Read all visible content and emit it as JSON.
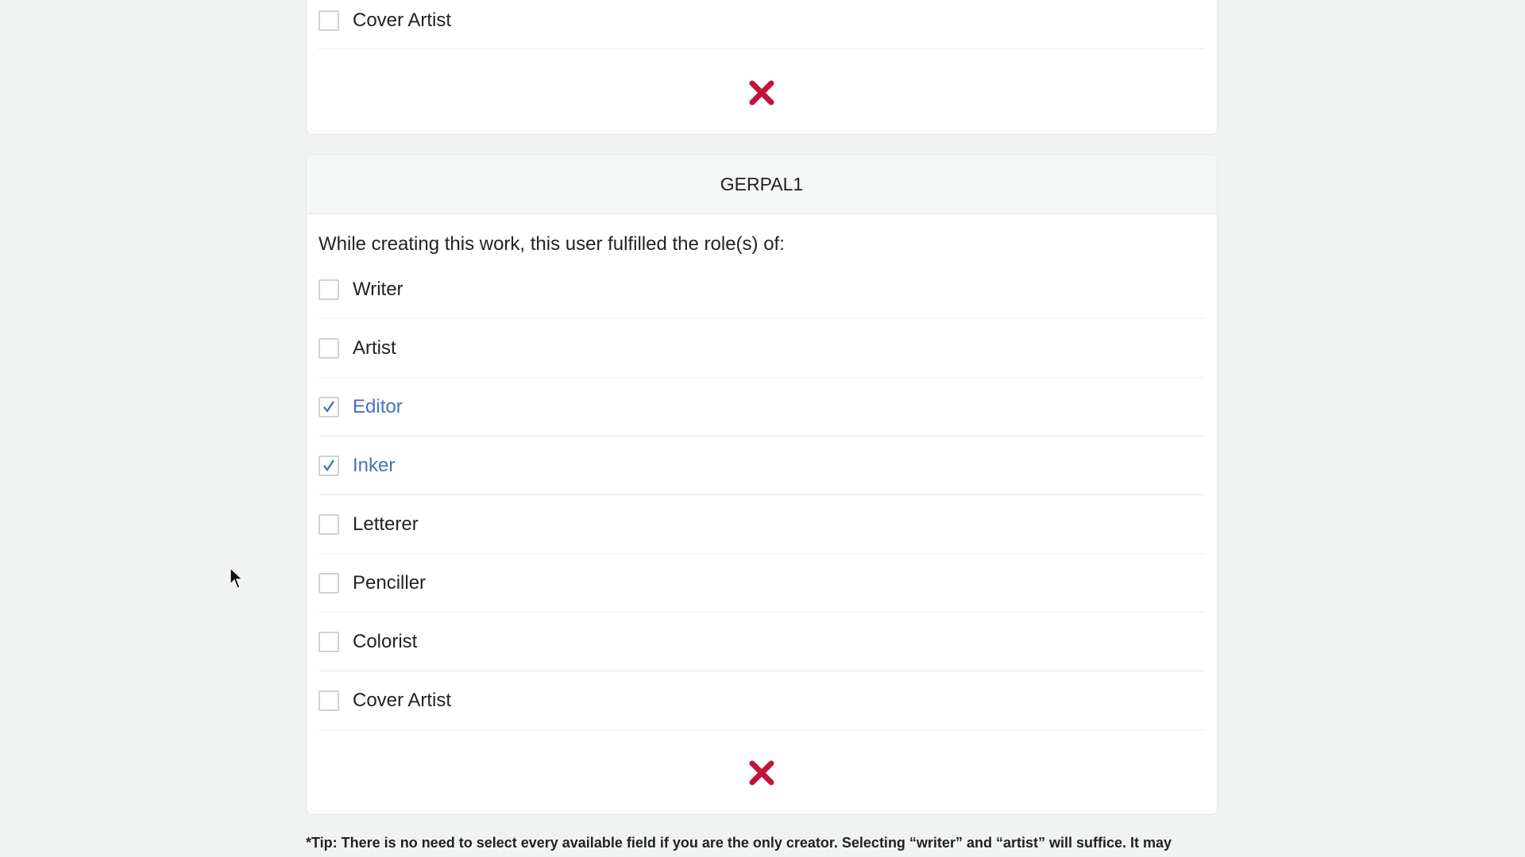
{
  "previous_card": {
    "roles": [
      {
        "label": "Cover Artist",
        "checked": false
      }
    ]
  },
  "card": {
    "username": "GERPAL1",
    "prompt": "While creating this work, this user fulfilled the role(s) of:",
    "roles": [
      {
        "label": "Writer",
        "checked": false
      },
      {
        "label": "Artist",
        "checked": false
      },
      {
        "label": "Editor",
        "checked": true
      },
      {
        "label": "Inker",
        "checked": true
      },
      {
        "label": "Letterer",
        "checked": false
      },
      {
        "label": "Penciller",
        "checked": false
      },
      {
        "label": "Colorist",
        "checked": false
      },
      {
        "label": "Cover Artist",
        "checked": false
      }
    ]
  },
  "tip": "*Tip: There is no need to select every available field if you are the only creator. Selecting “writer” and “artist” will suffice. It may",
  "icons": {
    "remove": "close-icon",
    "check": "checkmark-icon",
    "cursor": "mouse-pointer-icon"
  },
  "colors": {
    "remove_red": "#c0143c",
    "checked_blue": "#4472c4",
    "background": "#f1f3f3"
  }
}
